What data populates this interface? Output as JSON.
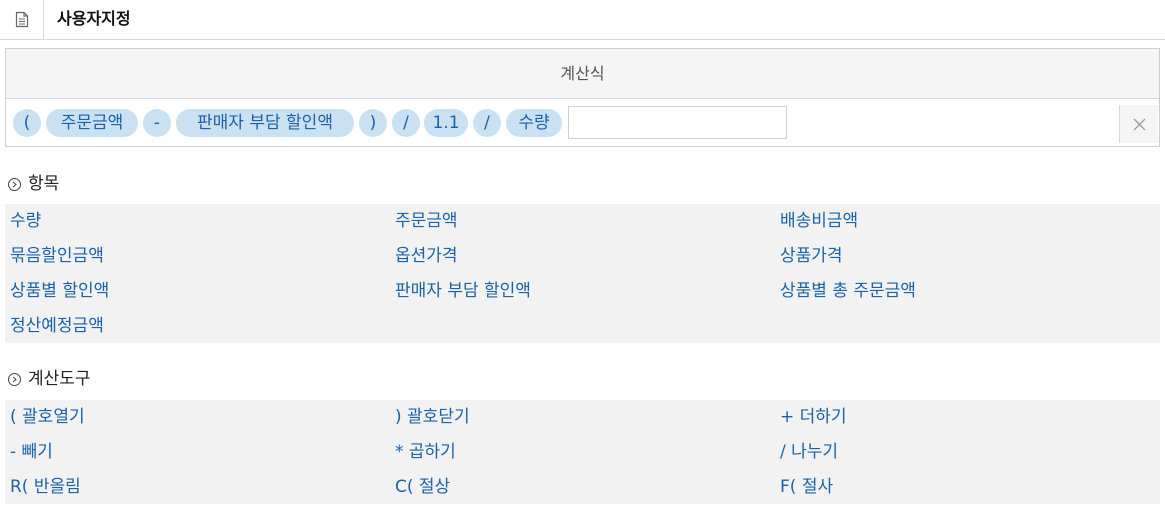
{
  "header": {
    "title": "사용자지정",
    "icon": "document-icon"
  },
  "formula": {
    "heading": "계산식",
    "tokens": [
      "(",
      "주문금액",
      "-",
      "판매자 부담 할인액",
      ")",
      "/",
      "1.1",
      "/",
      "수량"
    ],
    "input_value": "",
    "clear_icon": "close-icon"
  },
  "items_section": {
    "title": "항목",
    "items": [
      "수량",
      "주문금액",
      "배송비금액",
      "묶음할인금액",
      "옵션가격",
      "상품가격",
      "상품별 할인액",
      "판매자 부담 할인액",
      "상품별 총 주문금액",
      "정산예정금액"
    ]
  },
  "tools_section": {
    "title": "계산도구",
    "items": [
      "( 괄호열기",
      ") 괄호닫기",
      "+ 더하기",
      "- 빼기",
      "* 곱하기",
      "/ 나누기",
      "R( 반올림",
      "C( 절상",
      "F( 절사"
    ]
  },
  "colors": {
    "accent_text": "#1a62a8",
    "token_bg": "#c9e1f2",
    "panel_bg": "#f2f2f2"
  }
}
